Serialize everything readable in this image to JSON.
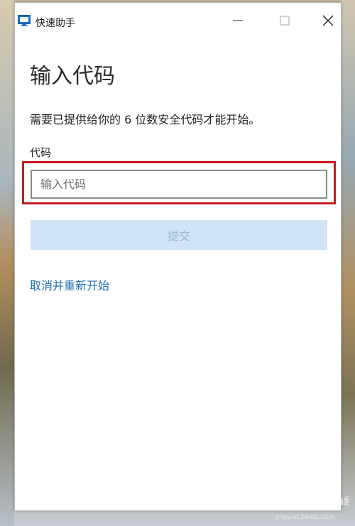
{
  "window": {
    "title": "快速助手",
    "icon": "quick-assist-icon"
  },
  "content": {
    "heading": "输入代码",
    "description": "需要已提供给你的 6 位数安全代码才能开始。",
    "code_label": "代码",
    "code_placeholder": "输入代码",
    "code_value": "",
    "submit_label": "提交",
    "cancel_link": "取消并重新开始"
  },
  "colors": {
    "accent": "#1f6fb5",
    "submit_disabled_bg": "#cfe4f7",
    "highlight": "#c8191f"
  },
  "watermark": {
    "brand": "Baidu经验",
    "url": "jingyan.baidu.com"
  }
}
